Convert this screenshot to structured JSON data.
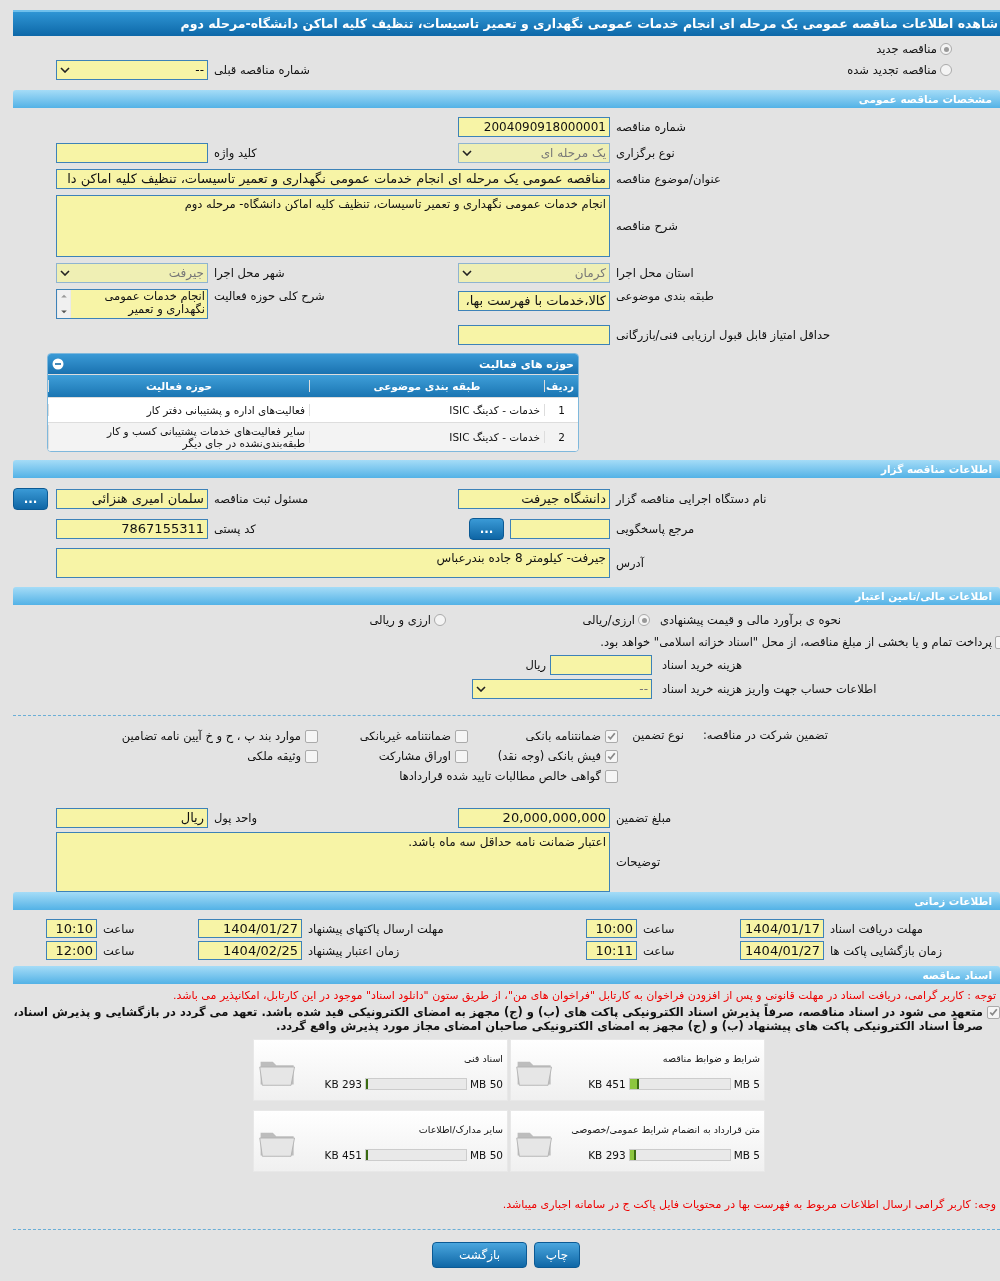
{
  "title": "شاهده اطلاعات مناقصه عمومی یک مرحله ای انجام خدمات عمومی نگهداری و تعمیر تاسیسات، تنظیف کلیه اماکن دانشگاه-مرحله دوم",
  "tender_kind": [
    {
      "label": "مناقصه جدید",
      "selected": true
    },
    {
      "label": "مناقصه تجدید شده",
      "selected": false
    }
  ],
  "previous_number": {
    "label": "شماره مناقصه قبلی",
    "value": "--"
  },
  "general": {
    "heading": "مشخصات مناقصه عمومی",
    "number": {
      "label": "شماره مناقصه",
      "value": "2004090918000001"
    },
    "method": {
      "label": "نوع برگزاری",
      "value": "یک مرحله ای"
    },
    "keyword": {
      "label": "کلید واژه"
    },
    "subject": {
      "label": "عنوان/موضوع مناقصه",
      "value": "مناقصه عمومی یک مرحله ای انجام خدمات عمومی نگهداری و تعمیر تاسیسات، تنظیف کلیه اماکن دا"
    },
    "description": {
      "label": "شرح مناقصه",
      "value": "انجام خدمات عمومی نگهداری و تعمیر تاسیسات، تنظیف کلیه اماکن دانشگاه- مرحله دوم"
    },
    "province": {
      "label": "استان محل اجرا",
      "value": "کرمان"
    },
    "city": {
      "label": "شهر محل اجرا",
      "value": "جیرفت"
    },
    "category": {
      "label": "طبقه بندی موضوعی",
      "value": "کالا،خدمات با فهرست بها،"
    },
    "activity_summary": {
      "label": "شرح کلی حوزه فعالیت",
      "value": "انجام خدمات عمومی نگهداری و تعمیر"
    },
    "min_score": {
      "label": "حداقل امتیاز قابل قبول ارزیابی فنی/بازرگانی"
    },
    "activities": {
      "heading": "حوزه های فعالیت",
      "columns": [
        "ردیف",
        "طبقه بندی موضوعی",
        "حوزه فعالیت"
      ],
      "rows": [
        [
          "1",
          "خدمات - کدینگ ISIC",
          "فعالیت‌های  اداره و پشتیبانی دفتر کار"
        ],
        [
          "2",
          "خدمات - کدینگ ISIC",
          "سایر فعالیت‌های خدمات پشتیبانی کسب و کار طبقه‌بندی‌نشده در جای دیگر"
        ]
      ]
    }
  },
  "organizer": {
    "heading": "اطلاعات مناقصه گزار",
    "agency": {
      "label": "نام دستگاه اجرایی مناقصه گزار",
      "value": "دانشگاه جیرفت"
    },
    "registrar": {
      "label": "مسئول ثبت مناقصه",
      "value": "سلمان امیری هنزائی",
      "button": "..."
    },
    "reference": {
      "label": "مرجع پاسخگویی",
      "button": "..."
    },
    "postal_code": {
      "label": "کد پستی",
      "value": "7867155311"
    },
    "address": {
      "label": "آدرس",
      "value": "جیرفت- کیلومتر 8 جاده بندرعباس"
    }
  },
  "finance": {
    "heading": "اطلاعات مالی/تامین اعتبار",
    "estimate_label": "نحوه ی برآورد مالی و قیمت پیشنهادی",
    "estimate_options": [
      {
        "label": "ارزی/ریالی",
        "selected": true
      },
      {
        "label": "ارزی و ریالی",
        "selected": false
      }
    ],
    "treasury": {
      "label": "پرداخت تمام و یا بخشی از مبلغ مناقصه، از محل \"اسناد خزانه اسلامی\" خواهد بود.",
      "checked": false
    },
    "doc_fee": {
      "label": "هزینه خرید اسناد",
      "unit": "ریال"
    },
    "account": {
      "label": "اطلاعات حساب جهت واریز هزینه خرید اسناد",
      "value": "--"
    }
  },
  "guarantee": {
    "label": "تضمین شرکت در مناقصه:",
    "type_label": "نوع تضمین",
    "options": [
      {
        "label": "ضمانتنامه بانکی",
        "checked": true
      },
      {
        "label": "ضمانتنامه غیربانکی",
        "checked": false
      },
      {
        "label": "موارد بند پ ، ح و خ آیین نامه تضامین",
        "checked": false
      },
      {
        "label": "فیش بانکی (وجه نقد)",
        "checked": true
      },
      {
        "label": "اوراق مشارکت",
        "checked": false
      },
      {
        "label": "وثیقه ملکی",
        "checked": false
      },
      {
        "label": "گواهی خالص مطالبات تایید شده قراردادها",
        "checked": false
      }
    ],
    "amount": {
      "label": "مبلغ تضمین",
      "value": "20,000,000,000"
    },
    "currency": {
      "label": "واحد پول",
      "value": "ریال"
    },
    "notes": {
      "label": "توضیحات",
      "value": "اعتبار ضمانت نامه حداقل سه ماه باشد."
    }
  },
  "timing": {
    "heading": "اطلاعات زمانی",
    "items": [
      {
        "label": "مهلت دریافت اسناد",
        "date": "1404/01/17",
        "time_label": "ساعت",
        "time": "10:00"
      },
      {
        "label": "مهلت ارسال پاکتهای پیشنهاد",
        "date": "1404/01/27",
        "time_label": "ساعت",
        "time": "10:10"
      },
      {
        "label": "زمان بازگشایی پاکت ها",
        "date": "1404/01/27",
        "time_label": "ساعت",
        "time": "10:11"
      },
      {
        "label": "زمان اعتبار پیشنهاد",
        "date": "1404/02/25",
        "time_label": "ساعت",
        "time": "12:00"
      }
    ]
  },
  "documents": {
    "heading": "اسناد مناقصه",
    "notice": "توجه : کاربر گرامی، دریافت اسناد در مهلت قانونی و پس از افزودن فراخوان به کارتابل \"فراخوان های من\"، از طریق ستون \"دانلود اسناد\" موجود در این کارتابل، امکانپذیر می باشد.",
    "commitment": {
      "text": "متعهد می شود در اسناد مناقصه، صرفاً پذیرش اسناد الکترونیکی پاکت های (ب) و (ج) مجهز به امضای الکترونیکی قید شده باشد. تعهد می گردد در بازگشایی و پذیرش اسناد، صرفاً اسناد الکترونیکی پاکت های پیشنهاد (ب) و (ج) مجهز به امضای الکترونیکی صاحبان امضای مجاز مورد پذیرش واقع گردد.",
      "checked": true
    },
    "files": [
      {
        "name": "شرایط و ضوابط مناقصه",
        "size": "451 KB",
        "limit": "5 MB",
        "level": 0.09
      },
      {
        "name": "اسناد فنی",
        "size": "293 KB",
        "limit": "50 MB",
        "level": 0.006
      },
      {
        "name": "متن قرارداد به انضمام شرایط عمومی/خصوصی",
        "size": "293 KB",
        "limit": "5 MB",
        "level": 0.06
      },
      {
        "name": "سایر مدارک/اطلاعات",
        "size": "451 KB",
        "limit": "50 MB",
        "level": 0.009
      }
    ],
    "footer_notice": "وجه: کاربر گرامی ارسال اطلاعات مربوط به فهرست بها در محتویات فایل پاکت ج در سامانه اجباری میباشد."
  },
  "buttons": [
    {
      "label": "چاپ"
    },
    {
      "label": "بازگشت"
    }
  ]
}
